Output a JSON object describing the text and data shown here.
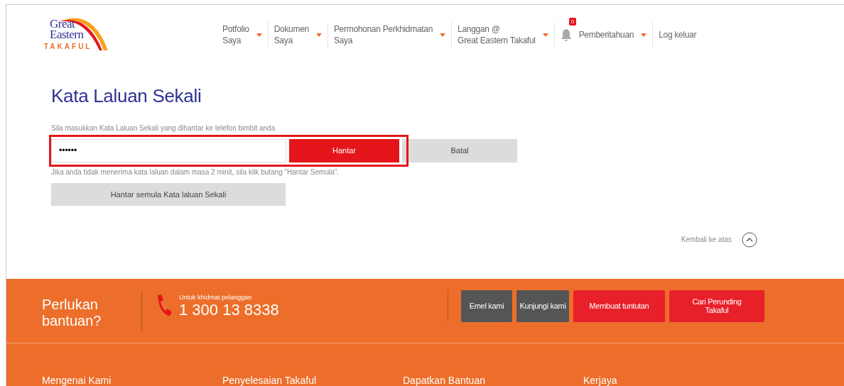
{
  "logo": {
    "line1": "Great",
    "line2": "Eastern",
    "line3": "TAKAFUL"
  },
  "nav": [
    {
      "kind": "menu",
      "label": "Potfolio\nSaya"
    },
    {
      "kind": "menu",
      "label": "Dokumen\nSaya"
    },
    {
      "kind": "menu",
      "label": "Permohonan Perkhidmatan\nSaya"
    },
    {
      "kind": "menu",
      "label": "Langgan @\nGreat Eastern Takaful"
    },
    {
      "kind": "notify",
      "label": "Pemberitahuan",
      "badge": "0"
    },
    {
      "kind": "link",
      "label": "Log keluar"
    }
  ],
  "page": {
    "title": "Kata Laluan Sekali",
    "instruction": "Sila masukkan Kata Laluan Sekali yang dihantar ke telefon bimbit anda",
    "otp_field": {
      "value": "••••••"
    },
    "submit": "Hantar",
    "cancel": "Batal",
    "hint": "Jika anda tidak menerima kata laluan dalam masa 2 minit, sila klik butang \"Hantar Semula\".",
    "resend": "Hantar semula Kata laluan Sekali",
    "back_to_top": "Kembali ke atas"
  },
  "footer": {
    "help": "Perlukan\nbantuan?",
    "service_label": "Untuk khidmat pelanggan",
    "phone": "1 300 13 8338",
    "actions": [
      {
        "kind": "dark",
        "label": "Emel kami"
      },
      {
        "kind": "dark",
        "label": "Kunjungi kami"
      },
      {
        "kind": "red",
        "label": "Membuat tuntutan"
      },
      {
        "kind": "red",
        "label": "Cari Perunding\nTakaful"
      }
    ],
    "links": [
      "Mengenai Kami",
      "Penyelesaian Takaful",
      "Dapatkan Bantuan",
      "Kerjaya"
    ]
  }
}
